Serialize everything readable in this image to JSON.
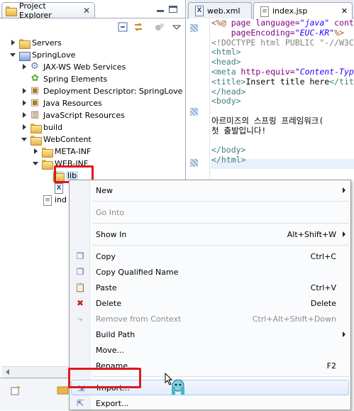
{
  "project_explorer": {
    "tab_label": "Project Explorer",
    "close_glyph": "✕",
    "tree": [
      {
        "label": "Servers",
        "level": 0,
        "twisty": "closed",
        "icon": "folder"
      },
      {
        "label": "SpringLove",
        "level": 0,
        "twisty": "open",
        "icon": "project"
      },
      {
        "label": "JAX-WS Web Services",
        "level": 1,
        "twisty": "closed",
        "icon": "gear"
      },
      {
        "label": "Spring Elements",
        "level": 1,
        "twisty": "none",
        "icon": "leaf"
      },
      {
        "label": "Deployment Descriptor: SpringLove",
        "level": 1,
        "twisty": "closed",
        "icon": "pkg"
      },
      {
        "label": "Java Resources",
        "level": 1,
        "twisty": "closed",
        "icon": "pkg"
      },
      {
        "label": "JavaScript Resources",
        "level": 1,
        "twisty": "closed",
        "icon": "lib"
      },
      {
        "label": "build",
        "level": 1,
        "twisty": "closed",
        "icon": "folder"
      },
      {
        "label": "WebContent",
        "level": 1,
        "twisty": "open",
        "icon": "folder"
      },
      {
        "label": "META-INF",
        "level": 2,
        "twisty": "closed",
        "icon": "folder"
      },
      {
        "label": "WEB-INF",
        "level": 2,
        "twisty": "open",
        "icon": "folder"
      },
      {
        "label": "lib",
        "level": 3,
        "twisty": "none",
        "icon": "folder",
        "selected": true
      },
      {
        "label": "",
        "level": 3,
        "twisty": "none",
        "icon": "xmlfile"
      },
      {
        "label": "ind",
        "level": 2,
        "twisty": "none",
        "icon": "jspfile"
      }
    ]
  },
  "editor": {
    "tabs": [
      {
        "label": "web.xml",
        "active": false
      },
      {
        "label": "index.jsp",
        "active": true
      }
    ],
    "code_lines": [
      [
        [
          "jsp",
          "<%@ "
        ],
        [
          "attr",
          "page language="
        ],
        [
          "str",
          "\"java\""
        ],
        [
          "attr",
          " cont"
        ]
      ],
      [
        [
          "attr",
          "    pageEncoding="
        ],
        [
          "str",
          "\"EUC-KR\""
        ],
        [
          "jsp",
          "%>"
        ]
      ],
      [
        [
          "doc",
          "<!DOCTYPE html PUBLIC \"-//W3C"
        ]
      ],
      [
        [
          "tag",
          "<html>"
        ]
      ],
      [
        [
          "tag",
          "<head>"
        ]
      ],
      [
        [
          "tag",
          "<meta "
        ],
        [
          "attr",
          "http-equiv="
        ],
        [
          "str",
          "\"Content-Typ"
        ]
      ],
      [
        [
          "tag",
          "<title>"
        ],
        [
          "txt",
          "Insert title here"
        ],
        [
          "tag",
          "</tit"
        ]
      ],
      [
        [
          "tag",
          "</head>"
        ]
      ],
      [
        [
          "tag",
          "<body>"
        ]
      ],
      [
        [
          "txt",
          ""
        ]
      ],
      [
        [
          "txt",
          "아르미즈의 스프링 프레임워크("
        ]
      ],
      [
        [
          "txt",
          "첫 출발입니다!"
        ]
      ],
      [
        [
          "txt",
          ""
        ]
      ],
      [
        [
          "tag",
          "</body>"
        ]
      ],
      [
        [
          "tag",
          "</html>"
        ]
      ]
    ]
  },
  "context_menu": {
    "items": [
      {
        "label": "New",
        "accel": "",
        "submenu": true,
        "icon": "",
        "disabled": false,
        "sep_after": true
      },
      {
        "label": "Go Into",
        "accel": "",
        "submenu": false,
        "icon": "",
        "disabled": true,
        "sep_after": true
      },
      {
        "label": "Show In",
        "accel": "Alt+Shift+W",
        "submenu": true,
        "icon": "",
        "disabled": false,
        "sep_after": true
      },
      {
        "label": "Copy",
        "accel": "Ctrl+C",
        "submenu": false,
        "icon": "copy-icon",
        "disabled": false,
        "sep_after": false
      },
      {
        "label": "Copy Qualified Name",
        "accel": "",
        "submenu": false,
        "icon": "copy-icon",
        "disabled": false,
        "sep_after": false
      },
      {
        "label": "Paste",
        "accel": "Ctrl+V",
        "submenu": false,
        "icon": "paste-icon",
        "disabled": false,
        "sep_after": false
      },
      {
        "label": "Delete",
        "accel": "Delete",
        "submenu": false,
        "icon": "delete-icon",
        "disabled": false,
        "sep_after": false
      },
      {
        "label": "Remove from Context",
        "accel": "Ctrl+Alt+Shift+Down",
        "submenu": false,
        "icon": "remove-icon",
        "disabled": true,
        "sep_after": false
      },
      {
        "label": "Build Path",
        "accel": "",
        "submenu": true,
        "icon": "",
        "disabled": false,
        "sep_after": false
      },
      {
        "label": "Move...",
        "accel": "",
        "submenu": false,
        "icon": "",
        "disabled": false,
        "sep_after": false
      },
      {
        "label": "Rename...",
        "accel": "F2",
        "submenu": false,
        "icon": "",
        "disabled": false,
        "sep_after": true
      },
      {
        "label": "Import...",
        "accel": "",
        "submenu": false,
        "icon": "import-icon",
        "disabled": false,
        "hover": true,
        "sep_after": false
      },
      {
        "label": "Export...",
        "accel": "",
        "submenu": false,
        "icon": "export-icon",
        "disabled": false,
        "sep_after": false
      }
    ]
  },
  "colors": {
    "highlight_red": "#e0181c",
    "menu_hover": "#e1ecfb",
    "selection": "#3399ff"
  }
}
